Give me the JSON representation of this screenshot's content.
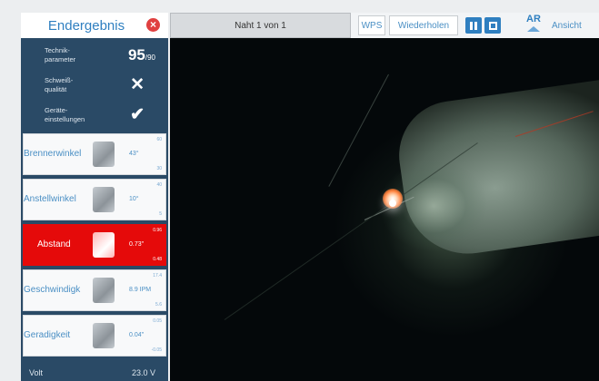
{
  "toolbar": {
    "seam_title": "Naht 1 von 1",
    "wps_label": "WPS",
    "repeat_label": "Wiederholen",
    "ar_label": "AR",
    "view_label": "Ansicht"
  },
  "panel": {
    "title": "Endergebnis",
    "close_icon": "close-icon",
    "params": [
      {
        "label": "Technik-\nparameter",
        "value": "95",
        "unit": "/90"
      },
      {
        "label": "Schweiß-\nqualität",
        "icon": "cross-icon"
      },
      {
        "label": "Geräte-\neinstellungen",
        "icon": "check-icon"
      }
    ],
    "cards": [
      {
        "label": "Brennerwinkel",
        "value": "43°",
        "max": "60",
        "min": "30",
        "active": false
      },
      {
        "label": "Anstellwinkel",
        "value": "10°",
        "max": "40",
        "min": "5",
        "active": false
      },
      {
        "label": "Abstand",
        "value": "0.73\"",
        "max": "0.96",
        "min": "0.48",
        "active": true
      },
      {
        "label": "Geschwindigk",
        "value": "8.9 IPM",
        "max": "17.4",
        "min": "5.6",
        "active": false
      },
      {
        "label": "Geradigkeit",
        "value": "0.04\"",
        "max": "0.05",
        "min": "-0.05",
        "active": false
      }
    ],
    "volt_label": "Volt",
    "volt_value": "23.0 V"
  },
  "colors": {
    "accent": "#2f7fc0",
    "panel_bg": "#2a4a66",
    "alert_red": "#e50a0a"
  }
}
